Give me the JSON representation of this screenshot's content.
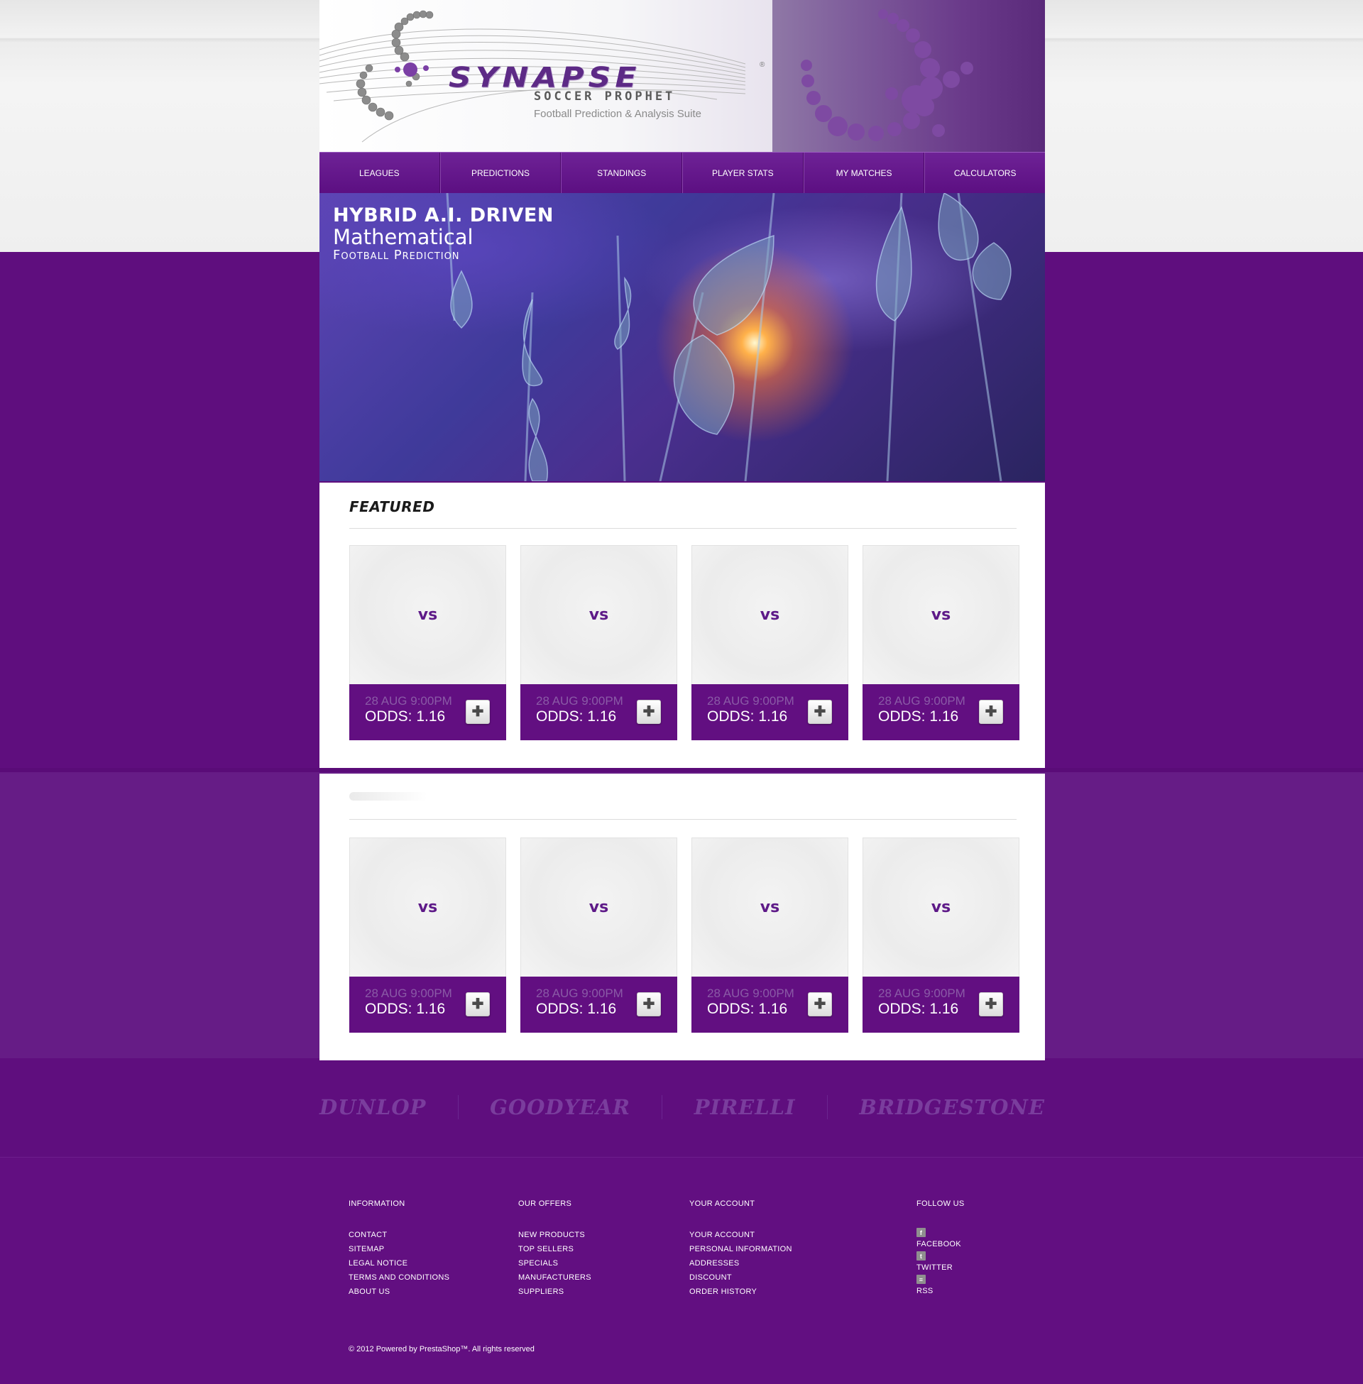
{
  "header": {
    "logo_text": "SYNAPSE",
    "logo_subtitle": "SOCCER PROPHET",
    "logo_tagline": "Football Prediction & Analysis Suite",
    "registered_mark": "®"
  },
  "nav": {
    "items": [
      "LEAGUES",
      "PREDICTIONS",
      "STANDINGS",
      "PLAYER STATS",
      "MY MATCHES",
      "CALCULATORS"
    ]
  },
  "hero": {
    "line1": "HYBRID A.I. DRIVEN",
    "line2": "Mathematical",
    "line3": "Football Prediction"
  },
  "featured": {
    "heading": "FEATURED",
    "cards": [
      {
        "vs": "vs",
        "date": "28 AUG 9:00PM",
        "odds": "ODDS: 1.16"
      },
      {
        "vs": "vs",
        "date": "28 AUG 9:00PM",
        "odds": "ODDS: 1.16"
      },
      {
        "vs": "vs",
        "date": "28 AUG 9:00PM",
        "odds": "ODDS: 1.16"
      },
      {
        "vs": "vs",
        "date": "28 AUG 9:00PM",
        "odds": "ODDS: 1.16"
      }
    ]
  },
  "second": {
    "cards": [
      {
        "vs": "vs",
        "date": "28 AUG 9:00PM",
        "odds": "ODDS: 1.16"
      },
      {
        "vs": "vs",
        "date": "28 AUG 9:00PM",
        "odds": "ODDS: 1.16"
      },
      {
        "vs": "vs",
        "date": "28 AUG 9:00PM",
        "odds": "ODDS: 1.16"
      },
      {
        "vs": "vs",
        "date": "28 AUG 9:00PM",
        "odds": "ODDS: 1.16"
      }
    ]
  },
  "add_button_glyph": "✚",
  "brands": [
    "DUNLOP",
    "GOODYEAR",
    "PIRELLI",
    "BRIDGESTONE"
  ],
  "footer": {
    "information": {
      "title": "INFORMATION",
      "links": [
        "CONTACT",
        "SITEMAP",
        "LEGAL NOTICE",
        "TERMS AND CONDITIONS",
        "ABOUT US"
      ]
    },
    "offers": {
      "title": "OUR OFFERS",
      "links": [
        "NEW PRODUCTS",
        "TOP SELLERS",
        "SPECIALS",
        "MANUFACTURERS",
        "SUPPLIERS"
      ]
    },
    "account": {
      "title": "YOUR ACCOUNT",
      "links": [
        "YOUR ACCOUNT",
        "PERSONAL INFORMATION",
        "ADDRESSES",
        "DISCOUNT",
        "ORDER HISTORY"
      ]
    },
    "follow": {
      "title": "FOLLOW US",
      "links": [
        {
          "icon": "facebook-icon",
          "glyph": "f",
          "label": "FACEBOOK"
        },
        {
          "icon": "twitter-icon",
          "glyph": "t",
          "label": "TWITTER"
        },
        {
          "icon": "rss-icon",
          "glyph": "≡",
          "label": "RSS"
        }
      ]
    },
    "copyright": "© 2012 Powered by PrestaShop™. All rights reserved"
  },
  "colors": {
    "brand_purple": "#620f81",
    "accent_purple": "#5e1a88",
    "page_light": "#f2f2f2"
  }
}
